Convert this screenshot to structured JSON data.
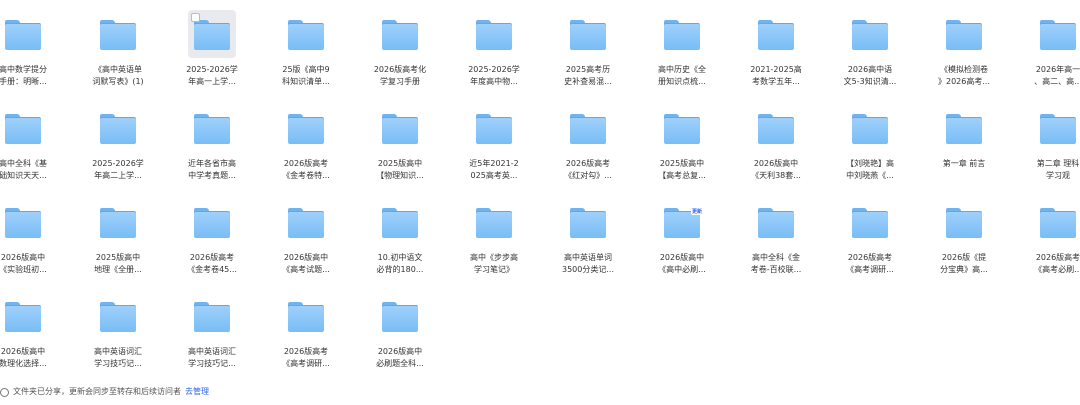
{
  "files": [
    {
      "name": "高中数学提分\n手册：明晰..."
    },
    {
      "name": "《高中英语单\n词默写表》(1)"
    },
    {
      "name": "2025-2026学\n年高一上学...",
      "selected": true
    },
    {
      "name": "25版《高中9\n科知识清单..."
    },
    {
      "name": "2026版高考化\n学复习手册"
    },
    {
      "name": "2025-2026学\n年度高中物..."
    },
    {
      "name": "2025高考历\n史补查易混..."
    },
    {
      "name": "高中历史《全\n册知识点梳..."
    },
    {
      "name": "2021-2025高\n考数学五年..."
    },
    {
      "name": "2026高中语\n文5-3知识清..."
    },
    {
      "name": "《模拟检测卷\n》2026高考..."
    },
    {
      "name": "2026年高一\n、高二、高..."
    },
    {
      "name": "高中全科《基\n础知识天天..."
    },
    {
      "name": "2025-2026学\n年高二上学..."
    },
    {
      "name": "近年各省市高\n中学考真题..."
    },
    {
      "name": "2026版高考\n《金考卷特..."
    },
    {
      "name": "2025版高中\n【物理知识..."
    },
    {
      "name": "近5年2021-2\n025高考英..."
    },
    {
      "name": "2026版高考\n《红对勾》..."
    },
    {
      "name": "2025版高中\n【高考总复..."
    },
    {
      "name": "2026版高中\n《天利38套..."
    },
    {
      "name": "【刘晓艳】高\n中刘晓燕《..."
    },
    {
      "name": "第一章 前言"
    },
    {
      "name": "第二章 理科\n学习观"
    },
    {
      "name": "2026版高中\n《实验班初..."
    },
    {
      "name": "2025版高中\n地理《全册..."
    },
    {
      "name": "2026版高考\n《金考卷45..."
    },
    {
      "name": "2026版高中\n《高考试题..."
    },
    {
      "name": "10.初中语文\n必背的180..."
    },
    {
      "name": "高中《步步高\n学习笔记》"
    },
    {
      "name": "高中英语单词\n3500分类记..."
    },
    {
      "name": "2026版高中\n《高中必刷...",
      "badge": "更新"
    },
    {
      "name": "高中全科《金\n考卷-百校联..."
    },
    {
      "name": "2026版高考\n《高考调研..."
    },
    {
      "name": "2026版《提\n分宝典》高..."
    },
    {
      "name": "2026版高考\n《高考必刷..."
    },
    {
      "name": "2026版高中\n数理化选择..."
    },
    {
      "name": "高中英语词汇\n学习技巧记..."
    },
    {
      "name": "高中英语词汇\n学习技巧记..."
    },
    {
      "name": "2026版高考\n《高考调研..."
    },
    {
      "name": "2026版高中\n必刷题全科..."
    }
  ],
  "status": {
    "message": "文件夹已分享，更新会同步至转存和后续访问者",
    "link": "去管理"
  }
}
